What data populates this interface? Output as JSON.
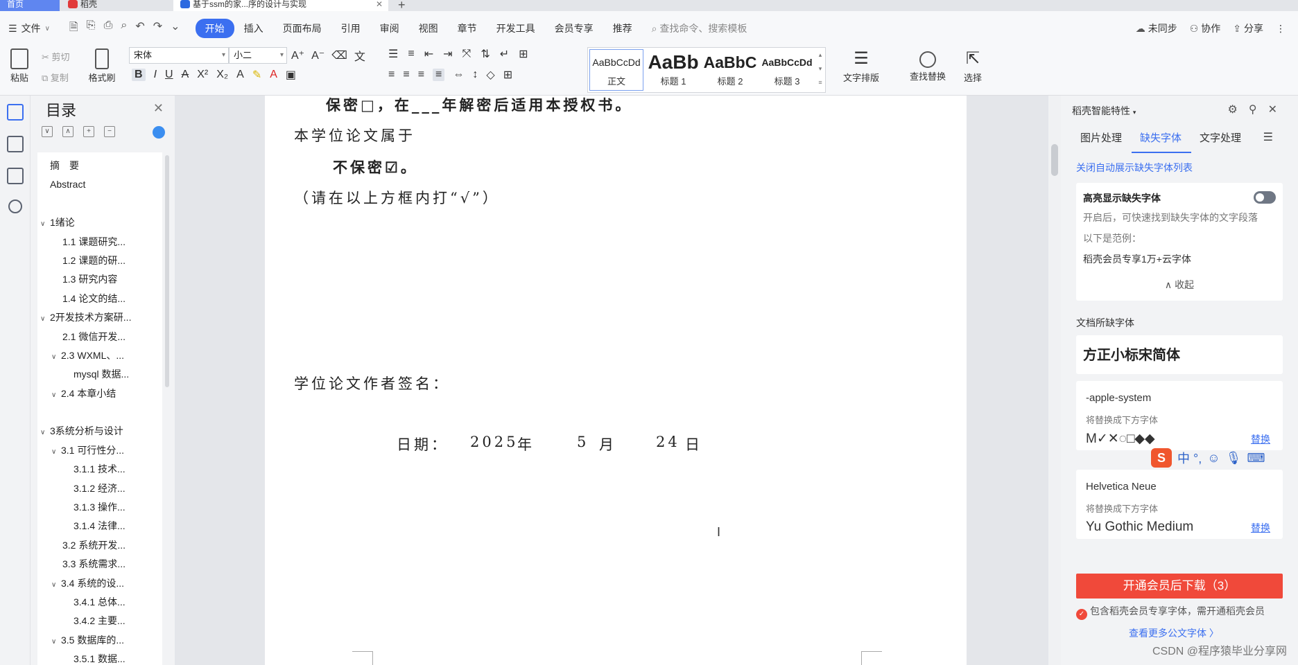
{
  "tabs": [
    {
      "label": "首页"
    },
    {
      "label": "稻壳"
    },
    {
      "label": "基于ssm的家...序的设计与实现"
    }
  ],
  "menu": {
    "file_label": "文件",
    "tabs": [
      "开始",
      "插入",
      "页面布局",
      "引用",
      "审阅",
      "视图",
      "章节",
      "开发工具",
      "会员专享",
      "推荐"
    ],
    "search_placeholder": "查找命令、搜索模板",
    "right": {
      "sync": "未同步",
      "collab": "协作",
      "share": "分享"
    }
  },
  "ribbon": {
    "paste": "粘贴",
    "cut": "剪切",
    "copy": "复制",
    "format_painter": "格式刷",
    "font_name": "宋体",
    "font_size": "小二",
    "styles": [
      {
        "preview": "AaBbCcDd",
        "name": "正文"
      },
      {
        "preview": "AaBb",
        "name": "标题 1"
      },
      {
        "preview": "AaBbC",
        "name": "标题 2"
      },
      {
        "preview": "AaBbCcDd",
        "name": "标题 3"
      }
    ],
    "text_layout": "文字排版",
    "find_replace": "查找替换",
    "select": "选择"
  },
  "toc": {
    "title": "目录",
    "items": [
      {
        "label": "摘　要",
        "level": 1,
        "arrow": ""
      },
      {
        "label": "Abstract",
        "level": 1,
        "arrow": ""
      },
      {
        "label": "",
        "level": 1,
        "arrow": ""
      },
      {
        "label": "1绪论",
        "level": 0,
        "arrow": "∨"
      },
      {
        "label": "1.1  课题研究...",
        "level": 2,
        "arrow": ""
      },
      {
        "label": "1.2  课题的研...",
        "level": 2,
        "arrow": ""
      },
      {
        "label": "1.3  研究内容",
        "level": 2,
        "arrow": ""
      },
      {
        "label": "1.4  论文的结...",
        "level": 2,
        "arrow": ""
      },
      {
        "label": "2开发技术方案研...",
        "level": 0,
        "arrow": "∨"
      },
      {
        "label": "2.1  微信开发...",
        "level": 2,
        "arrow": ""
      },
      {
        "label": "2.3 WXML、...",
        "level": 1,
        "arrow": "∨"
      },
      {
        "label": "mysql 数据...",
        "level": 3,
        "arrow": ""
      },
      {
        "label": "2.4  本章小结",
        "level": 1,
        "arrow": "∨"
      },
      {
        "label": "",
        "level": 1,
        "arrow": ""
      },
      {
        "label": "3系统分析与设计",
        "level": 0,
        "arrow": "∨"
      },
      {
        "label": "3.1  可行性分...",
        "level": 1,
        "arrow": "∨"
      },
      {
        "label": "3.1.1  技术...",
        "level": 3,
        "arrow": ""
      },
      {
        "label": "3.1.2  经济...",
        "level": 3,
        "arrow": ""
      },
      {
        "label": "3.1.3  操作...",
        "level": 3,
        "arrow": ""
      },
      {
        "label": "3.1.4  法律...",
        "level": 3,
        "arrow": ""
      },
      {
        "label": "3.2  系统开发...",
        "level": 2,
        "arrow": ""
      },
      {
        "label": "3.3  系统需求...",
        "level": 2,
        "arrow": ""
      },
      {
        "label": "3.4  系统的设...",
        "level": 1,
        "arrow": "∨"
      },
      {
        "label": "3.4.1  总体...",
        "level": 3,
        "arrow": ""
      },
      {
        "label": "3.4.2  主要...",
        "level": 3,
        "arrow": ""
      },
      {
        "label": "3.5  数据库的...",
        "level": 1,
        "arrow": "∨"
      },
      {
        "label": "3.5.1  数据...",
        "level": 3,
        "arrow": ""
      }
    ]
  },
  "doc": {
    "line1": "保密□，在___年解密后适用本授权书。",
    "line2": "本学位论文属于",
    "line3": "不保密☑。",
    "line4": "（请在以上方框内打“√”）",
    "signature": "学位论文作者签名：",
    "date_label": "日期：",
    "date_year": "2025",
    "year_unit": "年",
    "date_month": "5",
    "month_unit": "月",
    "date_day": "24",
    "day_unit": "日"
  },
  "panel": {
    "title": "稻壳智能特性",
    "tabs": [
      "图片处理",
      "缺失字体",
      "文字处理"
    ],
    "close_auto": "关闭自动展示缺失字体列表",
    "highlight_title": "高亮显示缺失字体",
    "highlight_desc": "开启后，可快速找到缺失字体的文字段落",
    "example_label": "以下是范例：",
    "example_text": "稻壳会员专享1万+云字体",
    "collapse": "收起",
    "missing_section": "文档所缺字体",
    "missing_font_main": "方正小标宋简体",
    "fonts": [
      {
        "name": "-apple-system",
        "hint": "将替换成下方字体",
        "replacement": "M✓✕◌□◆◆",
        "action": "替换"
      },
      {
        "name": "Helvetica Neue",
        "hint": "将替换成下方字体",
        "replacement": "Yu Gothic Medium",
        "action": "替换"
      }
    ],
    "cta": "开通会员后下载（3）",
    "cta_note": "包含稻壳会员专享字体，需开通稻壳会员",
    "more_link": "查看更多公文字体 〉",
    "ime": "中 °,"
  },
  "watermark": "CSDN @程序猿毕业分享网"
}
